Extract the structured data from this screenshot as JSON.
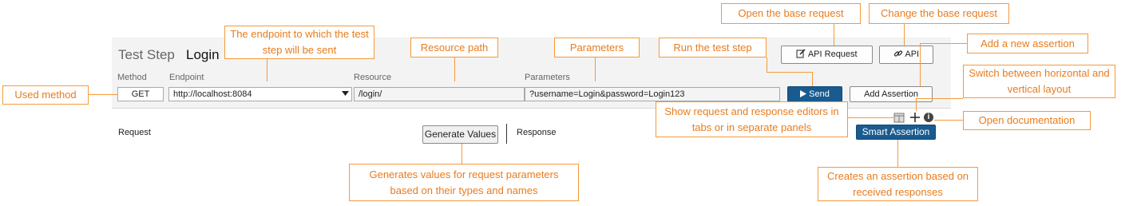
{
  "step": {
    "prefix": "Test Step",
    "name": "Login"
  },
  "labels": {
    "method": "Method",
    "endpoint": "Endpoint",
    "resource": "Resource",
    "parameters": "Parameters"
  },
  "fields": {
    "method": "GET",
    "endpoint": "http://localhost:8084",
    "resource": "/login/",
    "parameters": "?username=Login&password=Login123"
  },
  "buttons": {
    "api_request": "API Request",
    "api": "API",
    "send": "Send",
    "add_assertion": "Add Assertion",
    "generate_values": "Generate Values",
    "smart_assertion": "Smart Assertion"
  },
  "panes": {
    "request": "Request",
    "response": "Response"
  },
  "icons": {
    "api_request": "edit-icon",
    "api": "link-icon",
    "send": "play-icon",
    "layout": "panels-icon",
    "add": "plus-icon",
    "info": "info-icon",
    "dropdown": "dropdown-arrow-icon"
  },
  "callouts": {
    "used_method": "Used method",
    "endpoint": "The endpoint to which the test step will be sent",
    "resource_path": "Resource path",
    "parameters": "Parameters",
    "run_step": "Run the test step",
    "open_base": "Open the base request",
    "change_base": "Change the base request",
    "add_assertion": "Add a new assertion",
    "switch_layout": "Switch between horizontal and vertical layout",
    "show_editors": "Show request and response editors in tabs or in separate panels",
    "open_docs": "Open documentation",
    "generate_values": "Generates values for request parameters based on their types and names",
    "smart_assertion": "Creates an assertion based on received responses"
  },
  "colors": {
    "accent": "#f59a3a",
    "callout_text": "#e87c1e",
    "primary_button": "#1a5b8f"
  }
}
